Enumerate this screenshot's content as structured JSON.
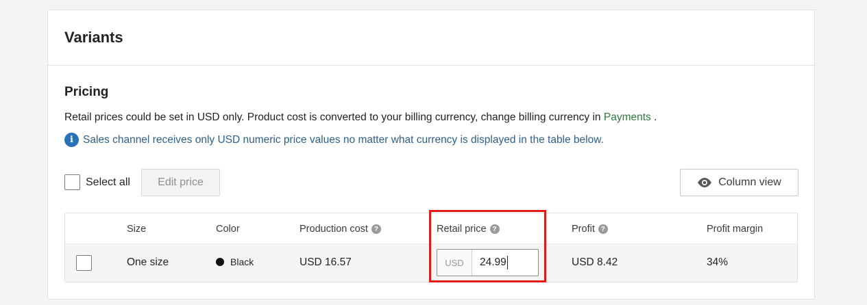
{
  "card": {
    "title": "Variants"
  },
  "pricing": {
    "title": "Pricing",
    "description_before": "Retail prices could be set in USD only. Product cost is converted to your billing currency, change billing currency in ",
    "payments_link": "Payments",
    "description_after": " .",
    "notice": "Sales channel receives only USD numeric price values no matter what currency is displayed in the table below."
  },
  "toolbar": {
    "select_all_label": "Select all",
    "edit_price_label": "Edit price",
    "column_view_label": "Column view"
  },
  "table": {
    "headers": {
      "size": "Size",
      "color": "Color",
      "production_cost": "Production cost",
      "retail_price": "Retail price",
      "profit": "Profit",
      "profit_margin": "Profit margin"
    },
    "rows": [
      {
        "size": "One size",
        "color": "Black",
        "color_hex": "#111111",
        "production_cost": "USD 16.57",
        "retail_currency": "USD",
        "retail_price": "24.99",
        "profit": "USD 8.42",
        "profit_margin": "34%"
      }
    ]
  },
  "colors": {
    "link": "#2a7a3b",
    "notice": "#2d5f8a",
    "highlight": "#e01919"
  }
}
